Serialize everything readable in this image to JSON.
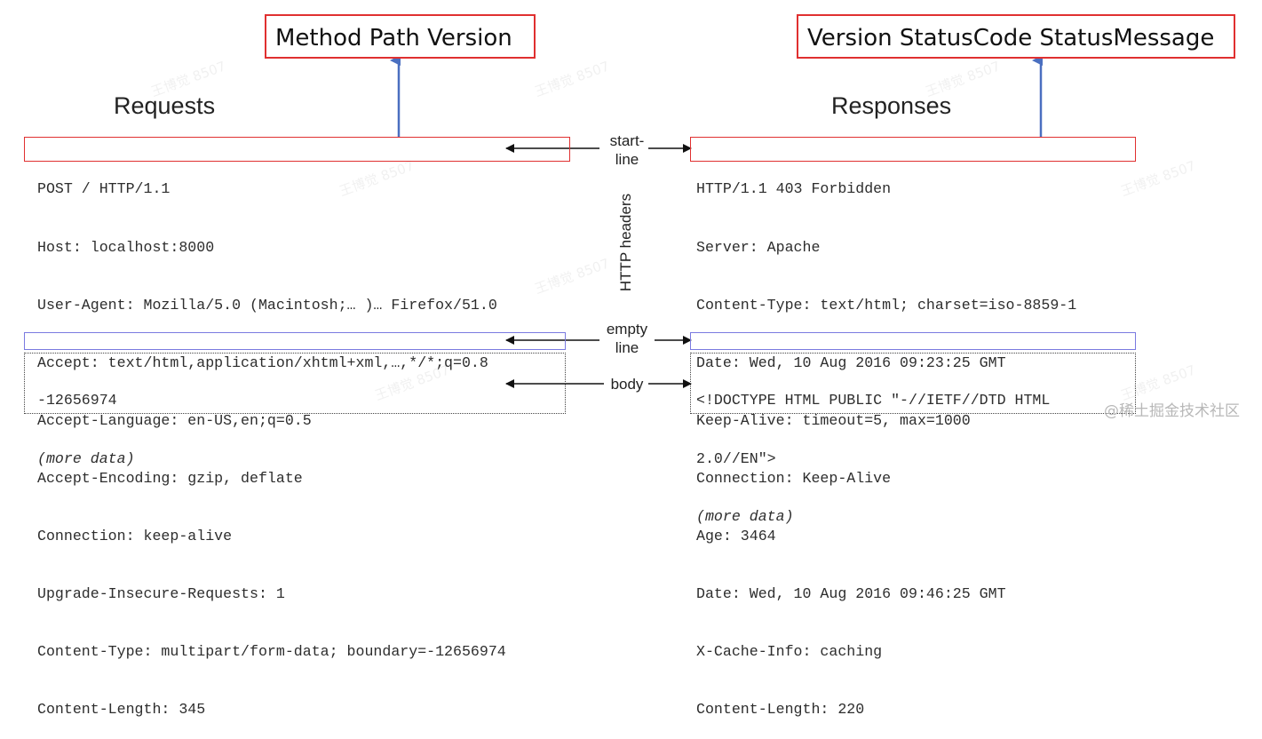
{
  "request": {
    "title_box": "Method Path Version",
    "heading": "Requests",
    "start_line": "POST / HTTP/1.1",
    "headers": [
      "Host: localhost:8000",
      "User-Agent: Mozilla/5.0 (Macintosh;… )… Firefox/51.0",
      "Accept: text/html,application/xhtml+xml,…,*/*;q=0.8",
      "Accept-Language: en-US,en;q=0.5",
      "Accept-Encoding: gzip, deflate",
      "Connection: keep-alive",
      "Upgrade-Insecure-Requests: 1",
      "Content-Type: multipart/form-data; boundary=-12656974",
      "Content-Length: 345"
    ],
    "body_lines": [
      "-12656974",
      "(more data)"
    ]
  },
  "response": {
    "title_box": "Version StatusCode StatusMessage",
    "heading": "Responses",
    "start_line": "HTTP/1.1 403 Forbidden",
    "headers": [
      "Server: Apache",
      "Content-Type: text/html; charset=iso-8859-1",
      "Date: Wed, 10 Aug 2016 09:23:25 GMT",
      "Keep-Alive: timeout=5, max=1000",
      "Connection: Keep-Alive",
      "Age: 3464",
      "Date: Wed, 10 Aug 2016 09:46:25 GMT",
      "X-Cache-Info: caching",
      "Content-Length: 220"
    ],
    "body_lines": [
      "<!DOCTYPE HTML PUBLIC \"-//IETF//DTD HTML",
      "2.0//EN\">",
      "(more data)"
    ]
  },
  "labels": {
    "start_line_1": "start-",
    "start_line_2": "line",
    "http_headers": "HTTP headers",
    "empty_line_1": "empty",
    "empty_line_2": "line",
    "body": "body"
  },
  "watermark": "王博觉 8507",
  "credit": "@稀土掘金技术社区",
  "colors": {
    "title_border": "#e03030",
    "up_arrow": "#4a6fc0",
    "empty_line_border": "#7a7ae0"
  }
}
